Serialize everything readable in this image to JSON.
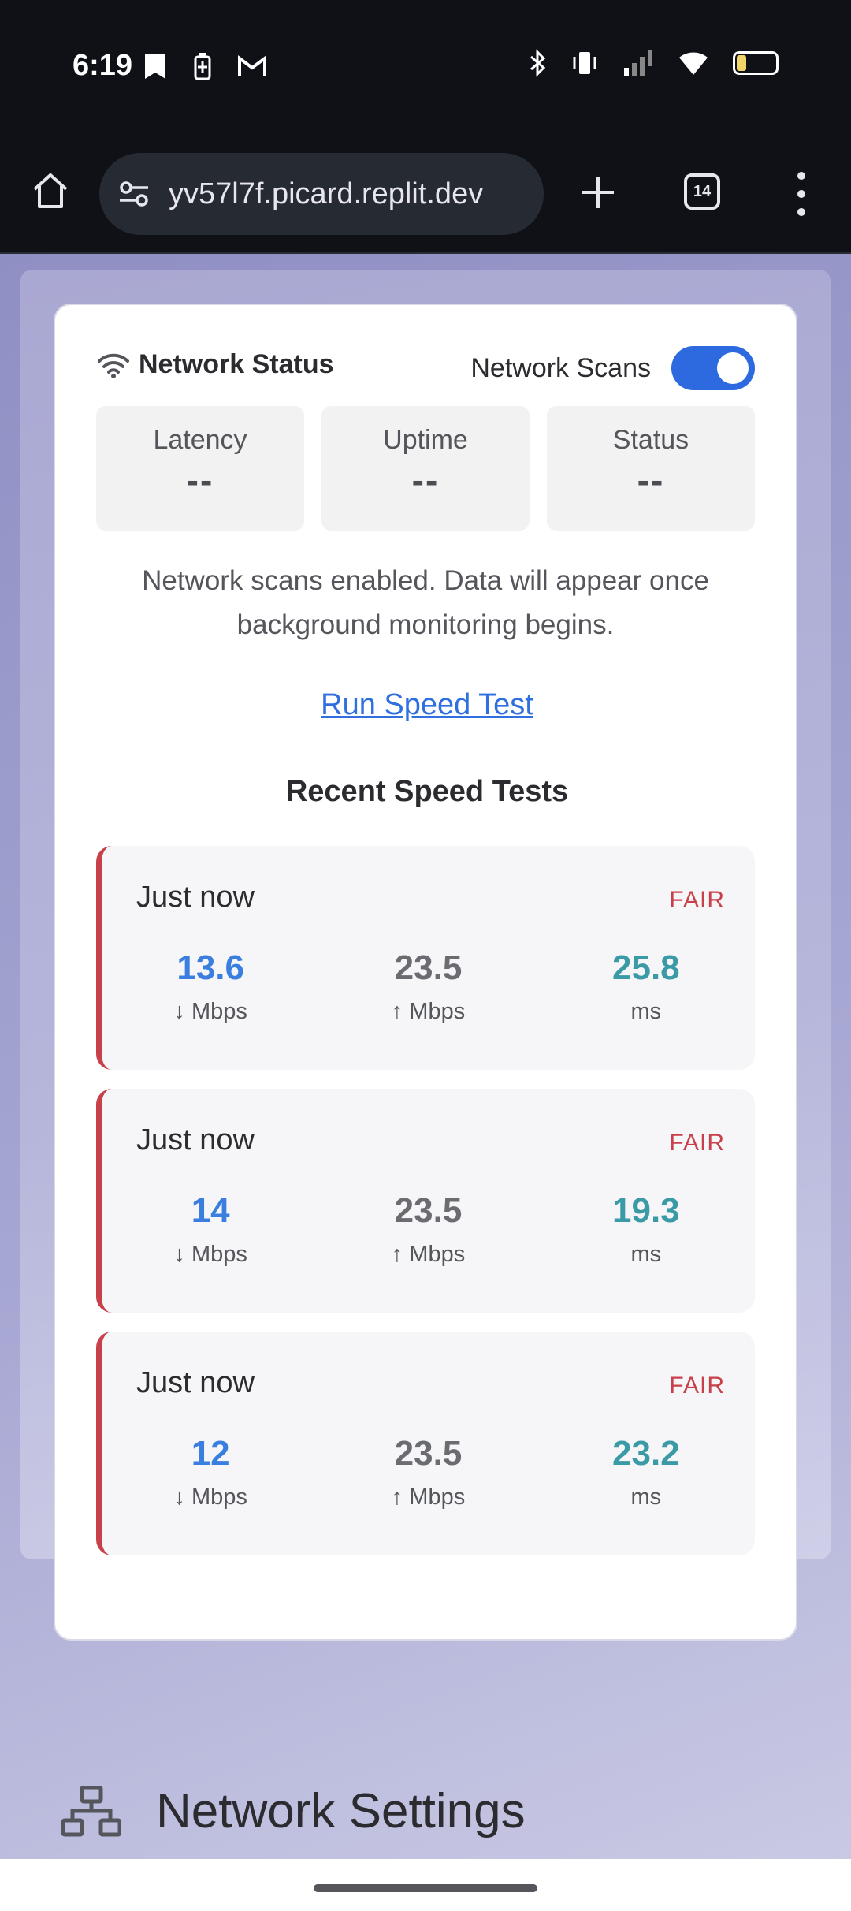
{
  "status_bar": {
    "time": "6:19"
  },
  "browser": {
    "url": "yv57l7f.picard.replit.dev",
    "tab_count": "14"
  },
  "network_status": {
    "title": "Network Status",
    "toggle_label": "Network Scans",
    "toggle_on": true,
    "stats": [
      {
        "label": "Latency",
        "value": "--"
      },
      {
        "label": "Uptime",
        "value": "--"
      },
      {
        "label": "Status",
        "value": "--"
      }
    ],
    "info_text": "Network scans enabled. Data will appear once background monitoring begins.",
    "run_speed_test": "Run Speed Test",
    "recent_title": "Recent Speed Tests",
    "tests": [
      {
        "when": "Just now",
        "grade": "FAIR",
        "download": "13.6",
        "download_unit": "↓ Mbps",
        "upload": "23.5",
        "upload_unit": "↑ Mbps",
        "latency": "25.8",
        "latency_unit": "ms"
      },
      {
        "when": "Just now",
        "grade": "FAIR",
        "download": "14",
        "download_unit": "↓ Mbps",
        "upload": "23.5",
        "upload_unit": "↑ Mbps",
        "latency": "19.3",
        "latency_unit": "ms"
      },
      {
        "when": "Just now",
        "grade": "FAIR",
        "download": "12",
        "download_unit": "↓ Mbps",
        "upload": "23.5",
        "upload_unit": "↑ Mbps",
        "latency": "23.2",
        "latency_unit": "ms"
      }
    ]
  },
  "network_settings": {
    "title": "Network Settings"
  },
  "colors": {
    "accent": "#2d6ae0",
    "fair": "#c8404a",
    "download": "#3a7ee0",
    "latency": "#3a9aa6"
  }
}
